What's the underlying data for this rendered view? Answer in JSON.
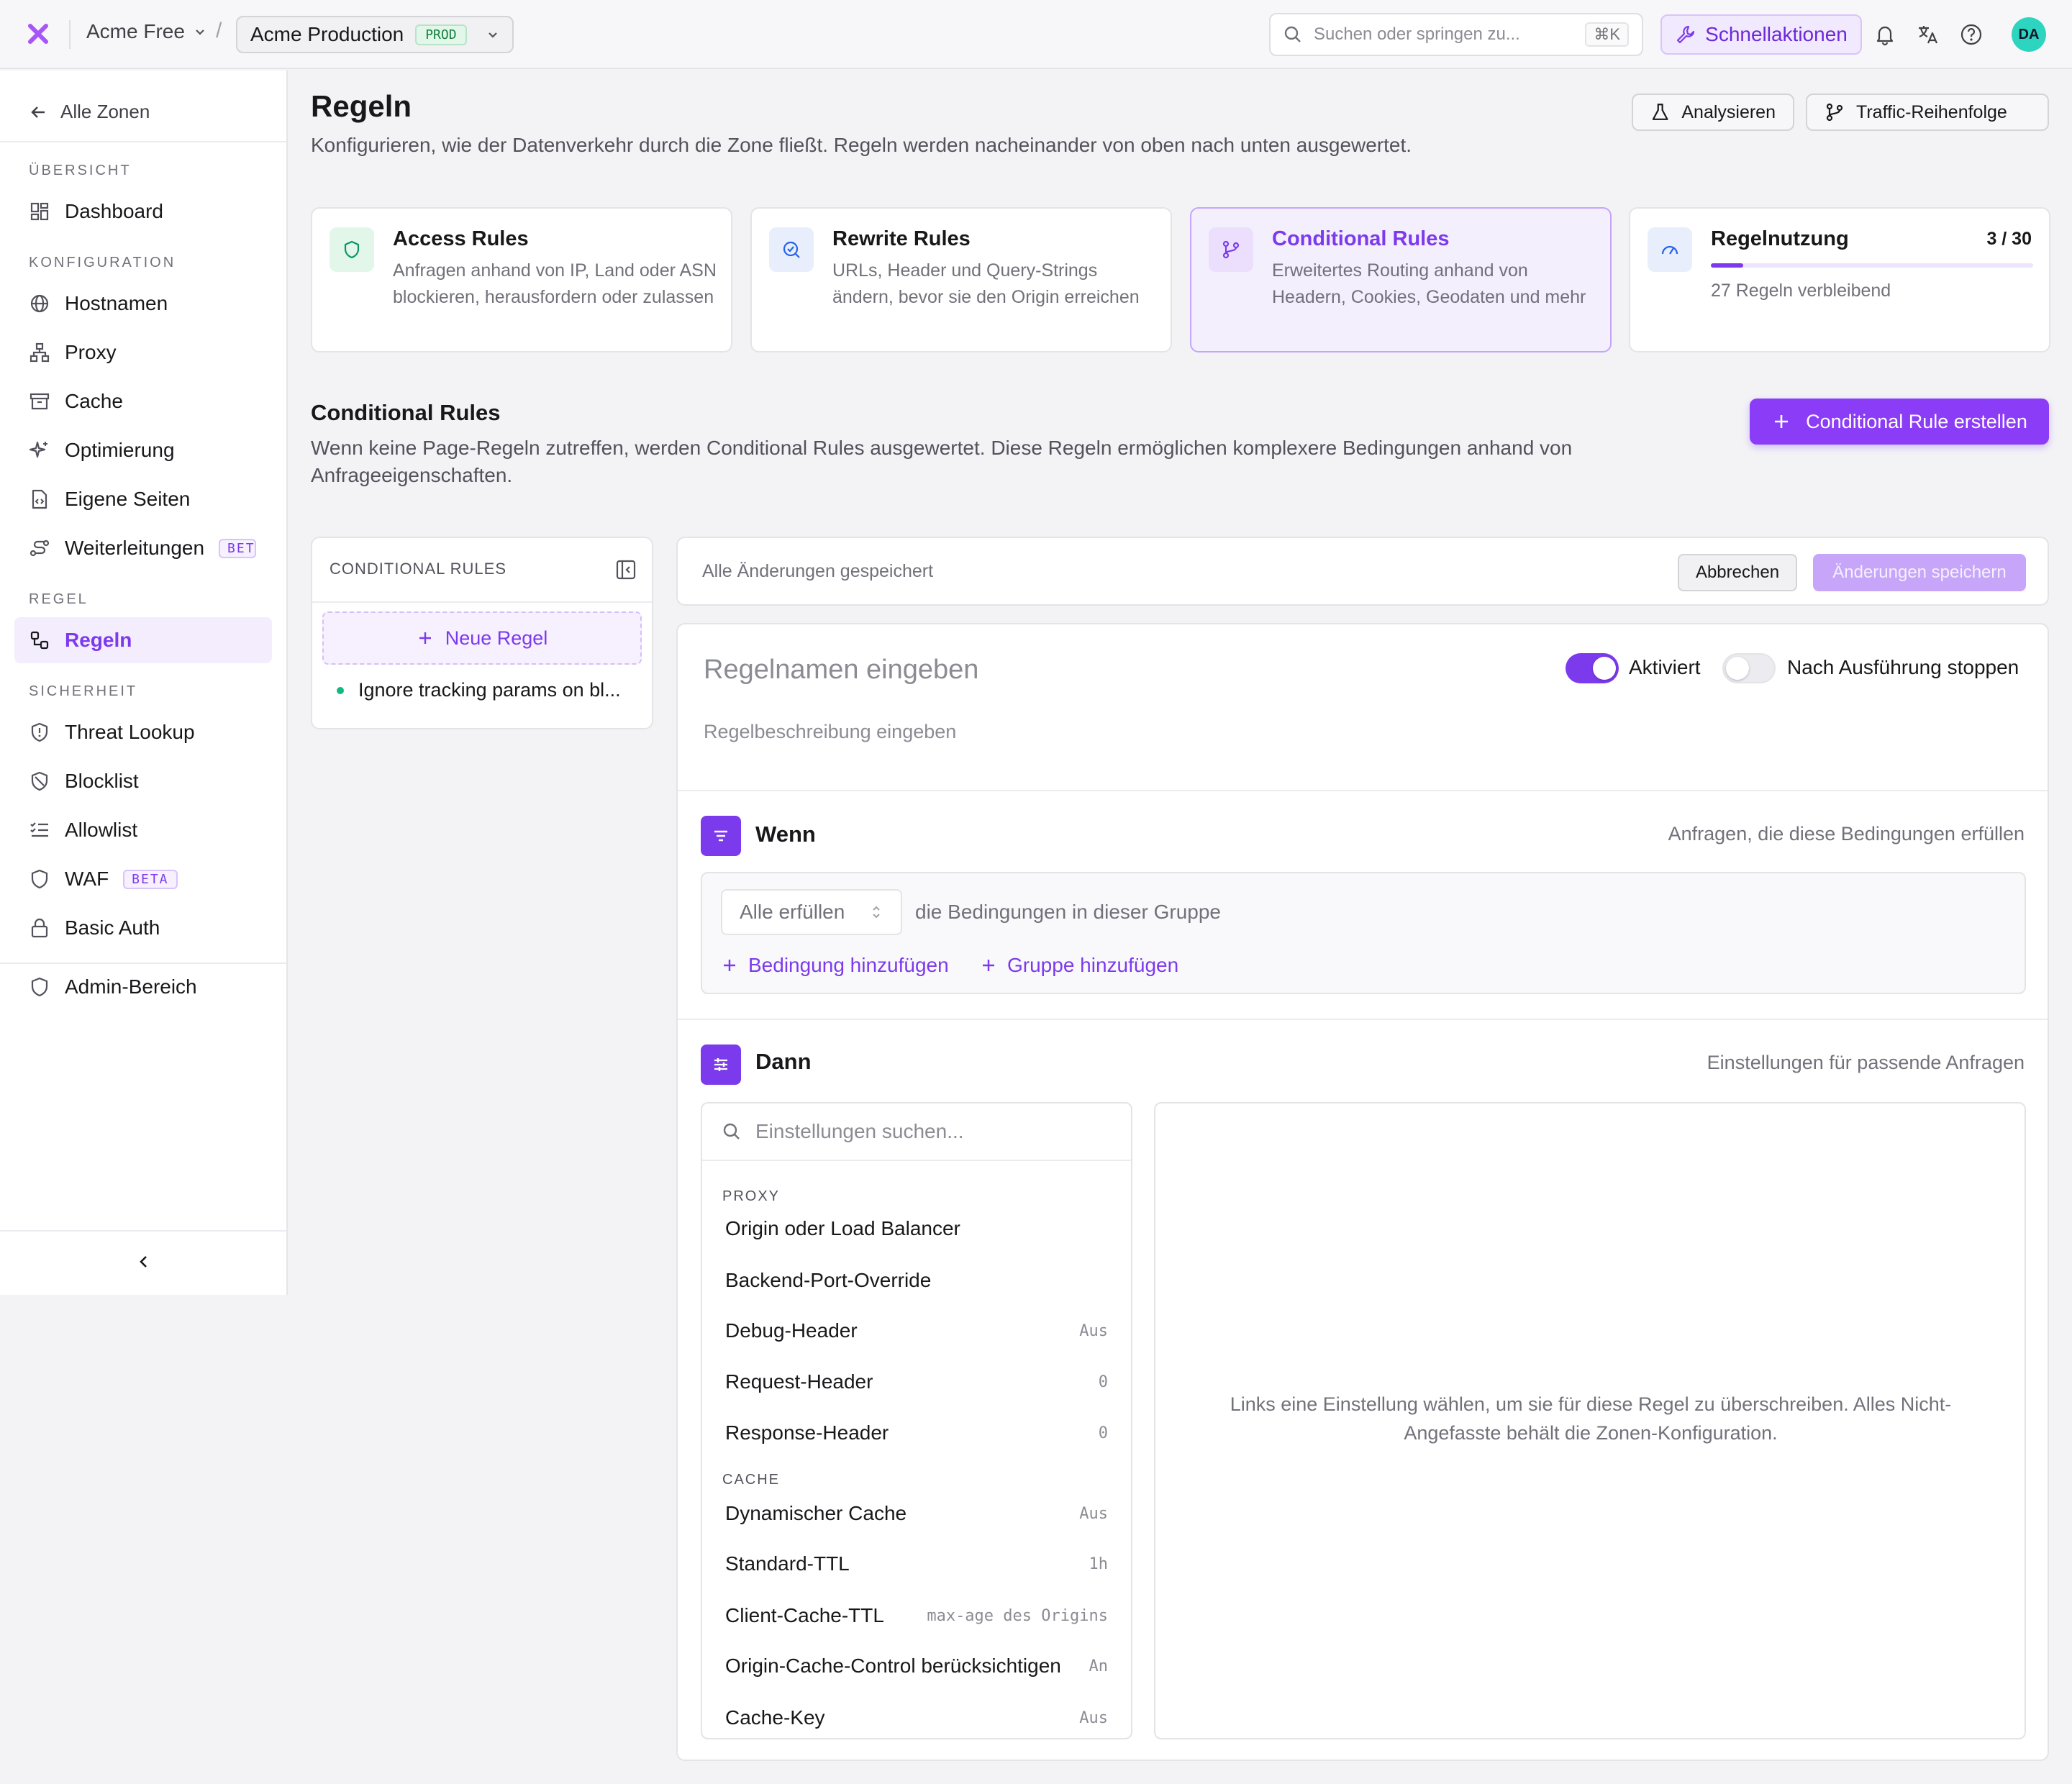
{
  "topbar": {
    "org": "Acme Free",
    "zone": "Acme Production",
    "zone_badge": "PROD",
    "search_placeholder": "Suchen oder springen zu...",
    "search_shortcut": "⌘K",
    "quick_actions": "Schnellaktionen",
    "avatar": "DA",
    "accent": "#7c3aed"
  },
  "sidebar": {
    "back": "Alle Zonen",
    "sections": {
      "overview": "ÜBERSICHT",
      "config": "KONFIGURATION",
      "rule": "REGEL",
      "security": "SICHERHEIT"
    },
    "items": {
      "dashboard": "Dashboard",
      "hostnames": "Hostnamen",
      "proxy": "Proxy",
      "cache": "Cache",
      "optimization": "Optimierung",
      "custom_pages": "Eigene Seiten",
      "redirects": "Weiterleitungen",
      "redirects_badge": "BETA",
      "rules": "Regeln",
      "threat_lookup": "Threat Lookup",
      "blocklist": "Blocklist",
      "allowlist": "Allowlist",
      "waf": "WAF",
      "waf_badge": "BETA",
      "basic_auth": "Basic Auth",
      "admin": "Admin-Bereich"
    }
  },
  "header": {
    "title": "Regeln",
    "subtitle": "Konfigurieren, wie der Datenverkehr durch die Zone fließt. Regeln werden nacheinander von oben nach unten ausgewertet.",
    "analyze": "Analysieren",
    "traffic_order": "Traffic-Reihenfolge"
  },
  "cards": {
    "access": {
      "title": "Access Rules",
      "desc": "Anfragen anhand von IP, Land oder ASN blockieren, herausfordern oder zulassen"
    },
    "rewrite": {
      "title": "Rewrite Rules",
      "desc": "URLs, Header und Query-Strings ändern, bevor sie den Origin erreichen"
    },
    "conditional": {
      "title": "Conditional Rules",
      "desc": "Erweitertes Routing anhand von Headern, Cookies, Geodaten und mehr"
    },
    "usage": {
      "title": "Regelnutzung",
      "count": "3 / 30",
      "used": 3,
      "limit": 30,
      "remaining": "27 Regeln verbleibend"
    }
  },
  "section": {
    "title": "Conditional Rules",
    "desc": "Wenn keine Page-Regeln zutreffen, werden Conditional Rules ausgewertet. Diese Regeln ermöglichen komplexere Bedingungen anhand von Anfrageeigenschaften.",
    "create": "Conditional Rule erstellen"
  },
  "rule_list": {
    "heading": "CONDITIONAL RULES",
    "new_rule": "Neue Regel",
    "rules": [
      "Ignore tracking params on bl..."
    ]
  },
  "save_bar": {
    "status": "Alle Änderungen gespeichert",
    "cancel": "Abbrechen",
    "save": "Änderungen speichern"
  },
  "editor": {
    "name_placeholder": "Regelnamen eingeben",
    "desc_placeholder": "Regelbeschreibung eingeben",
    "enabled_label": "Aktiviert",
    "stop_label": "Nach Ausführung stoppen",
    "when": {
      "title": "Wenn",
      "hint": "Anfragen, die diese Bedingungen erfüllen",
      "match_mode": "Alle erfüllen",
      "match_text": "die Bedingungen in dieser Gruppe",
      "add_condition": "Bedingung hinzufügen",
      "add_group": "Gruppe hinzufügen"
    },
    "then": {
      "title": "Dann",
      "hint": "Einstellungen für passende Anfragen",
      "search_placeholder": "Einstellungen suchen...",
      "categories": {
        "proxy": {
          "label": "PROXY",
          "items": [
            {
              "name": "Origin oder Load Balancer",
              "value": ""
            },
            {
              "name": "Backend-Port-Override",
              "value": ""
            },
            {
              "name": "Debug-Header",
              "value": "Aus"
            },
            {
              "name": "Request-Header",
              "value": "0"
            },
            {
              "name": "Response-Header",
              "value": "0"
            }
          ]
        },
        "cache": {
          "label": "CACHE",
          "items": [
            {
              "name": "Dynamischer Cache",
              "value": "Aus"
            },
            {
              "name": "Standard-TTL",
              "value": "1h"
            },
            {
              "name": "Client-Cache-TTL",
              "value": "max-age des Origins"
            },
            {
              "name": "Origin-Cache-Control berücksichtigen",
              "value": "An"
            },
            {
              "name": "Cache-Key",
              "value": "Aus"
            }
          ]
        }
      },
      "empty_hint": "Links eine Einstellung wählen, um sie für diese Regel zu überschreiben. Alles Nicht-Angefasste behält die Zonen-Konfiguration."
    }
  }
}
